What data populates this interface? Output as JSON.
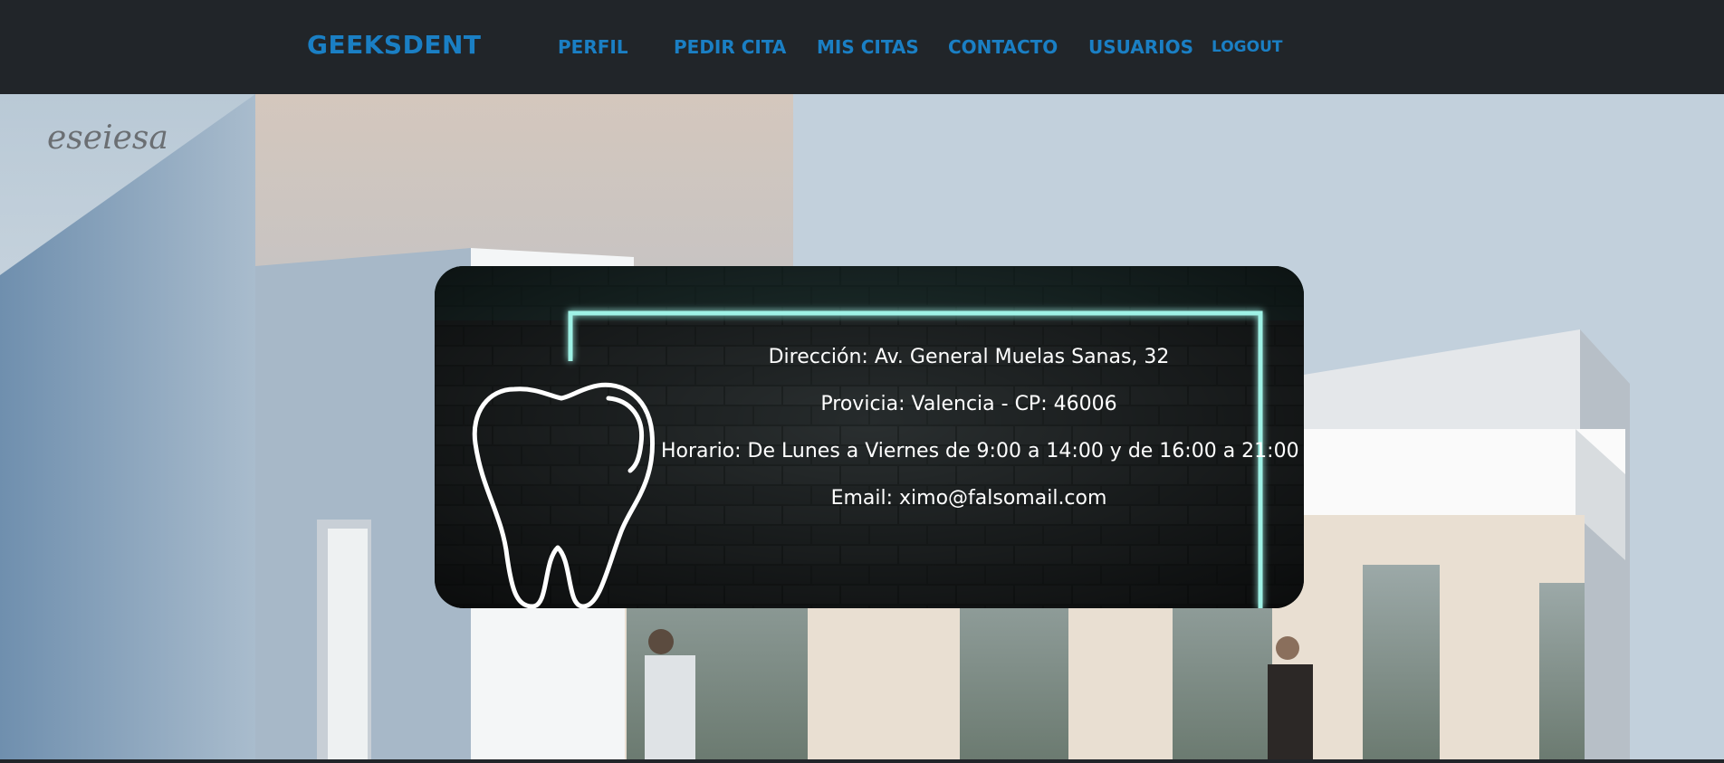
{
  "navbar": {
    "brand": "GEEKSDENT",
    "links": [
      {
        "label": "PERFIL"
      },
      {
        "label": "PEDIR CITA"
      },
      {
        "label": "MIS CITAS"
      },
      {
        "label": "CONTACTO"
      },
      {
        "label": "USUARIOS"
      },
      {
        "label": "LOGOUT"
      }
    ]
  },
  "hero": {
    "watermark": "eseiesa"
  },
  "contact_card": {
    "lines": [
      "Dirección: Av. General Muelas Sanas, 32",
      "Provicia: Valencia - CP: 46006",
      "Horario: De Lunes a Viernes de 9:00 a 14:00 y de 16:00 a 21:00",
      "Email: ximo@falsomail.com"
    ],
    "icon": "tooth-icon"
  },
  "colors": {
    "navbar_bg": "#212529",
    "link": "#1a7fc4",
    "neon": "#9ff2e6"
  }
}
